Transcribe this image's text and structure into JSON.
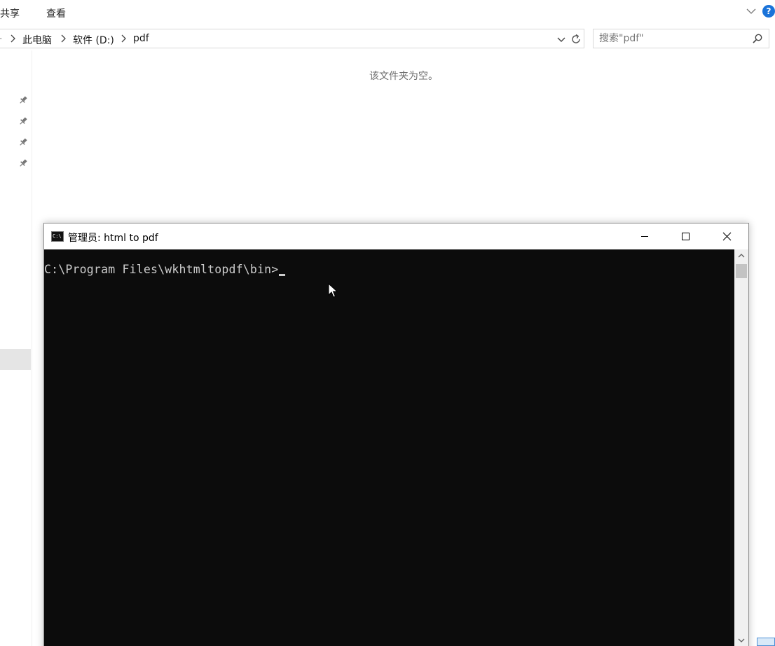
{
  "explorer": {
    "ribbon": {
      "tabs": [
        "共享",
        "查看"
      ]
    },
    "address": {
      "fragment": ".",
      "crumbs": [
        "此电脑",
        "软件 (D:)",
        "pdf"
      ]
    },
    "search": {
      "placeholder": "搜索\"pdf\""
    },
    "empty_message": "该文件夹为空。"
  },
  "console": {
    "title": "管理员:  html to pdf",
    "icon_text": "C:\\",
    "prompt": "C:\\Program Files\\wkhtmltopdf\\bin>"
  },
  "icons": {
    "ribbon": [
      "chevron-down-icon",
      "help-icon"
    ],
    "address": [
      "chevron-right-icon",
      "chevron-down-icon",
      "refresh-icon"
    ],
    "search": "search-icon",
    "nav_pane": [
      "pin-icon",
      "pin-icon",
      "pin-icon",
      "pin-icon"
    ],
    "console": [
      "cmd-icon",
      "minimize-icon",
      "maximize-icon",
      "close-icon"
    ]
  },
  "colors": {
    "console_background": "#0c0c0c",
    "console_text": "#cccccc",
    "help_accent": "#1a73d9"
  }
}
